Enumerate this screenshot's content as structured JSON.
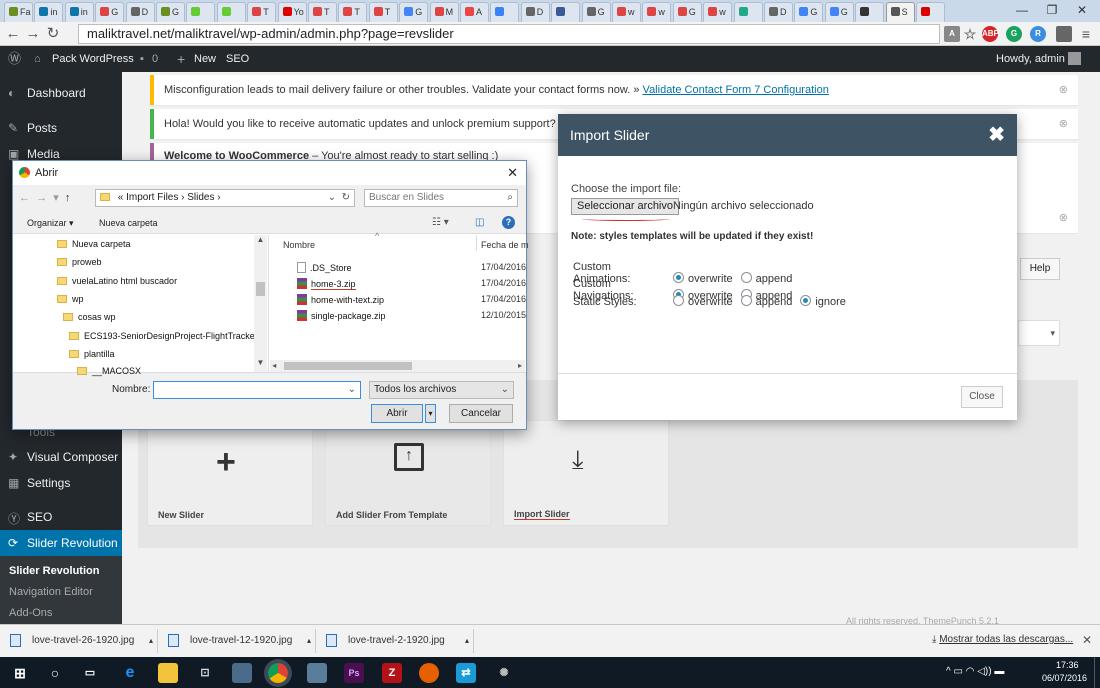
{
  "browser": {
    "tabs": [
      "Fa",
      "in",
      "in",
      "G",
      "D",
      "G",
      "",
      "",
      "T",
      "Yo",
      "T",
      "T",
      "T",
      "G",
      "M",
      "A",
      "",
      "D",
      "",
      "G",
      "w",
      "w",
      "G",
      "w",
      "",
      "D",
      "G",
      "G",
      "",
      "S",
      ""
    ],
    "active_tab_label": "S",
    "url": "maliktravel.net/maliktravel/wp-admin/admin.php?page=revslider",
    "extensions": [
      "ABP",
      "G",
      "R",
      "≡"
    ]
  },
  "adminbar": {
    "site": "Pack WordPress",
    "comments": "0",
    "new": "New",
    "seo": "SEO",
    "howdy": "Howdy, admin"
  },
  "sidebar": {
    "dashboard": "Dashboard",
    "posts": "Posts",
    "media": "Media",
    "tools": "Tools",
    "visual_composer": "Visual Composer",
    "settings": "Settings",
    "seo": "SEO",
    "slider_revolution": "Slider Revolution",
    "sub": [
      "Slider Revolution",
      "Navigation Editor",
      "Add-Ons"
    ]
  },
  "notices": {
    "contact_form": "Misconfiguration leads to mail delivery failure or other troubles. Validate your contact forms now. »",
    "contact_form_link": "Validate Contact Form 7 Configuration",
    "updates": "Hola! Would you like to receive automatic updates and unlock premium support? Plea",
    "woo_bold": "Welcome to WooCommerce",
    "woo_rest": " – You're almost ready to start selling :)",
    "help": "Help"
  },
  "cards": [
    "New Slider",
    "Add Slider From Template",
    "Import Slider"
  ],
  "footer_right": "All rights reserved. ThemePunch 5.2.1",
  "modal": {
    "title": "Import Slider",
    "choose_label": "Choose the import file:",
    "file_button": "Seleccionar archivo",
    "file_status": "Ningún archivo seleccionado",
    "note": "Note: styles templates will be updated if they exist!",
    "rows": [
      {
        "label": "Custom Animations:",
        "options": [
          "overwrite",
          "append"
        ],
        "selected": "overwrite"
      },
      {
        "label": "Custom Navigations:",
        "options": [
          "overwrite",
          "append"
        ],
        "selected": "overwrite"
      },
      {
        "label": "Static Styles:",
        "options": [
          "overwrite",
          "append",
          "ignore"
        ],
        "selected": "ignore"
      }
    ],
    "close": "Close"
  },
  "dialog": {
    "title": "Abrir",
    "breadcrumb": [
      "«",
      "Import Files",
      "Slides"
    ],
    "search_placeholder": "Buscar en Slides",
    "organize": "Organizar",
    "new_folder": "Nueva carpeta",
    "tree": [
      "Nueva carpeta",
      "proweb",
      "vuelaLatino html buscador",
      "wp",
      "cosas wp",
      "ECS193-SeniorDesignProject-FlightTracker",
      "plantilla",
      "__MACOSX"
    ],
    "col_name": "Nombre",
    "col_date": "Fecha de m",
    "files": [
      {
        "name": ".DS_Store",
        "date": "17/04/2016"
      },
      {
        "name": "home-3.zip",
        "date": "17/04/2016"
      },
      {
        "name": "home-with-text.zip",
        "date": "17/04/2016"
      },
      {
        "name": "single-package.zip",
        "date": "12/10/2015"
      }
    ],
    "filename_label": "Nombre:",
    "filter": "Todos los archivos",
    "open": "Abrir",
    "cancel": "Cancelar"
  },
  "downloads": {
    "items": [
      "love-travel-26-1920.jpg",
      "love-travel-12-1920.jpg",
      "love-travel-2-1920.jpg"
    ],
    "show_all": "Mostrar todas las descargas..."
  },
  "taskbar": {
    "time": "17:36",
    "date": "06/07/2016"
  },
  "colors": {
    "wp_dark": "#23282d",
    "wp_blue": "#0073aa",
    "modal_header": "#3e5465",
    "notice_yellow": "#ffb900"
  }
}
